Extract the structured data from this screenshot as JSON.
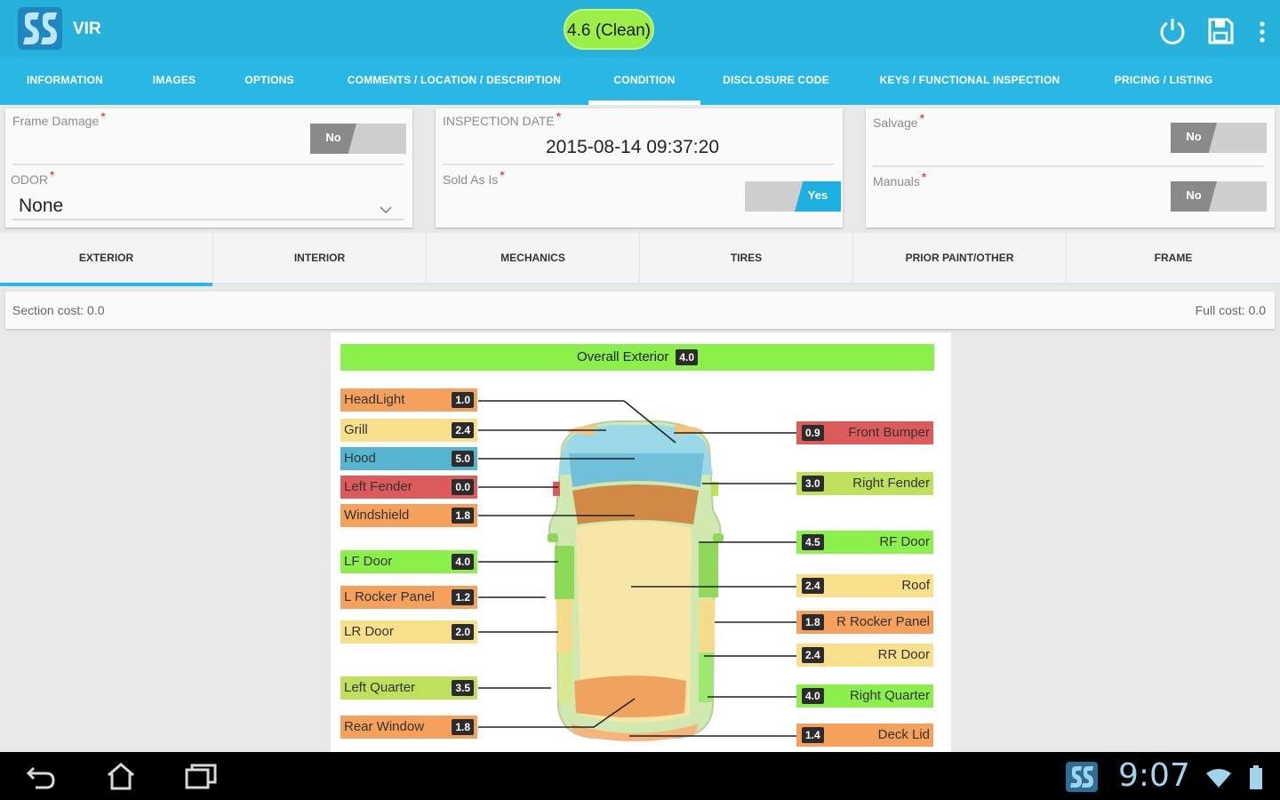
{
  "app": {
    "title": "VIR",
    "score": "4.6 (Clean)"
  },
  "tabs": [
    {
      "label": "Information"
    },
    {
      "label": "Images"
    },
    {
      "label": "Options"
    },
    {
      "label": "Comments / Location / Description"
    },
    {
      "label": "Condition",
      "active": true
    },
    {
      "label": "Disclosure Code"
    },
    {
      "label": "Keys / Functional Inspection"
    },
    {
      "label": "Pricing / Listing"
    }
  ],
  "form": {
    "frame_damage": {
      "label": "Frame Damage",
      "value": "No"
    },
    "odor": {
      "label": "ODOR",
      "value": "None"
    },
    "inspection_date": {
      "label": "INSPECTION DATE",
      "value": "2015-08-14 09:37:20"
    },
    "sold_as_is": {
      "label": "Sold As Is",
      "value": "Yes"
    },
    "salvage": {
      "label": "Salvage",
      "value": "No"
    },
    "manuals": {
      "label": "Manuals",
      "value": "No"
    },
    "required_mark": "*"
  },
  "sections": [
    {
      "label": "Exterior",
      "active": true
    },
    {
      "label": "Interior"
    },
    {
      "label": "Mechanics"
    },
    {
      "label": "Tires"
    },
    {
      "label": "Prior Paint/Other"
    },
    {
      "label": "Frame"
    }
  ],
  "costs": {
    "section": "Section cost: 0.0",
    "full": "Full cost: 0.0"
  },
  "diagram": {
    "overall_label": "Overall Exterior",
    "overall_value": "4.0",
    "left_parts": [
      {
        "label": "HeadLight",
        "value": "1.0",
        "color": "#f5a15c"
      },
      {
        "label": "Grill",
        "value": "2.4",
        "color": "#f9e08a"
      },
      {
        "label": "Hood",
        "value": "5.0",
        "color": "#55b5cf"
      },
      {
        "label": "Left Fender",
        "value": "0.0",
        "color": "#de5b5b"
      },
      {
        "label": "Windshield",
        "value": "1.8",
        "color": "#f5a15c"
      },
      {
        "label": "LF Door",
        "value": "4.0",
        "color": "#8cf04a"
      },
      {
        "label": "L Rocker Panel",
        "value": "1.2",
        "color": "#f5a15c"
      },
      {
        "label": "LR Door",
        "value": "2.0",
        "color": "#f9e08a"
      },
      {
        "label": "Left Quarter",
        "value": "3.5",
        "color": "#bfe05a"
      },
      {
        "label": "Rear Window",
        "value": "1.8",
        "color": "#f5a15c"
      }
    ],
    "right_parts": [
      {
        "label": "Front Bumper",
        "value": "0.9",
        "color": "#de5b5b"
      },
      {
        "label": "Right Fender",
        "value": "3.0",
        "color": "#bfe05a"
      },
      {
        "label": "RF Door",
        "value": "4.5",
        "color": "#8cf04a"
      },
      {
        "label": "Roof",
        "value": "2.4",
        "color": "#f9e08a"
      },
      {
        "label": "R Rocker Panel",
        "value": "1.8",
        "color": "#f5a15c"
      },
      {
        "label": "RR Door",
        "value": "2.4",
        "color": "#f9e08a"
      },
      {
        "label": "Right Quarter",
        "value": "4.0",
        "color": "#8cf04a"
      },
      {
        "label": "Deck Lid",
        "value": "1.4",
        "color": "#f5a15c"
      }
    ]
  },
  "system": {
    "time": "9:07"
  }
}
